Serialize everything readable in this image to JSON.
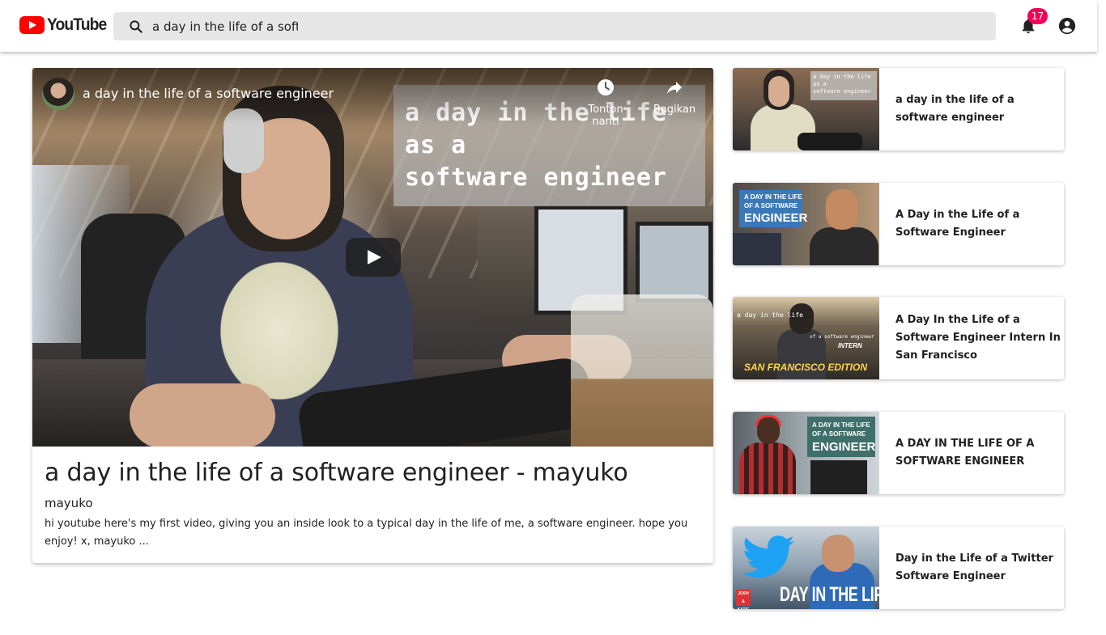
{
  "header": {
    "logo_text": "YouTube",
    "search": {
      "value": "a day in the life of a softw",
      "placeholder": ""
    },
    "notifications_count": "17"
  },
  "player": {
    "video_title": "a day in the life of a software engineer",
    "overlay_lines": [
      "a day in the life",
      "as a",
      "software engineer"
    ],
    "watch_later_label": "Tonton nanti",
    "share_label": "Bagikan"
  },
  "main": {
    "title": "a day in the life of a software engineer - mayuko",
    "channel": "mayuko",
    "description": "hi youtube here's my first video, giving you an inside look to a typical day in the life of me, a software engineer. hope you enjoy! x, mayuko ..."
  },
  "related": [
    {
      "title": "a day in the life of a software engineer",
      "thumb_text": [
        "a day in the life",
        "as a",
        "software engineer"
      ]
    },
    {
      "title": "A Day in the Life of a Software Engineer",
      "thumb_text": [
        "A DAY IN THE LIFE",
        "OF A SOFTWARE",
        "ENGINEER"
      ]
    },
    {
      "title": "A Day In the Life of a Software Engineer Intern In San Francisco",
      "thumb_text": [
        "a day in the life",
        "of a software engineer",
        "INTERN",
        "SAN FRANCISCO EDITION"
      ]
    },
    {
      "title": "A DAY IN THE LIFE OF A SOFTWARE ENGINEER",
      "thumb_text": [
        "A DAY IN THE LIFE",
        "OF A SOFTWARE",
        "ENGINEER"
      ]
    },
    {
      "title": "Day in the Life of a Twitter Software Engineer",
      "thumb_text": [
        "JOSH & KATIE",
        "DAY IN THE LIFE"
      ]
    }
  ],
  "colors": {
    "brand_red": "#ff0000",
    "badge": "#f50057",
    "search_bg": "#e6e6e6"
  },
  "icons": {
    "search": "search-icon",
    "notifications": "bell-icon",
    "account": "account-circle-icon",
    "watch_later": "clock-icon",
    "share": "share-arrow-icon",
    "play": "play-icon"
  }
}
